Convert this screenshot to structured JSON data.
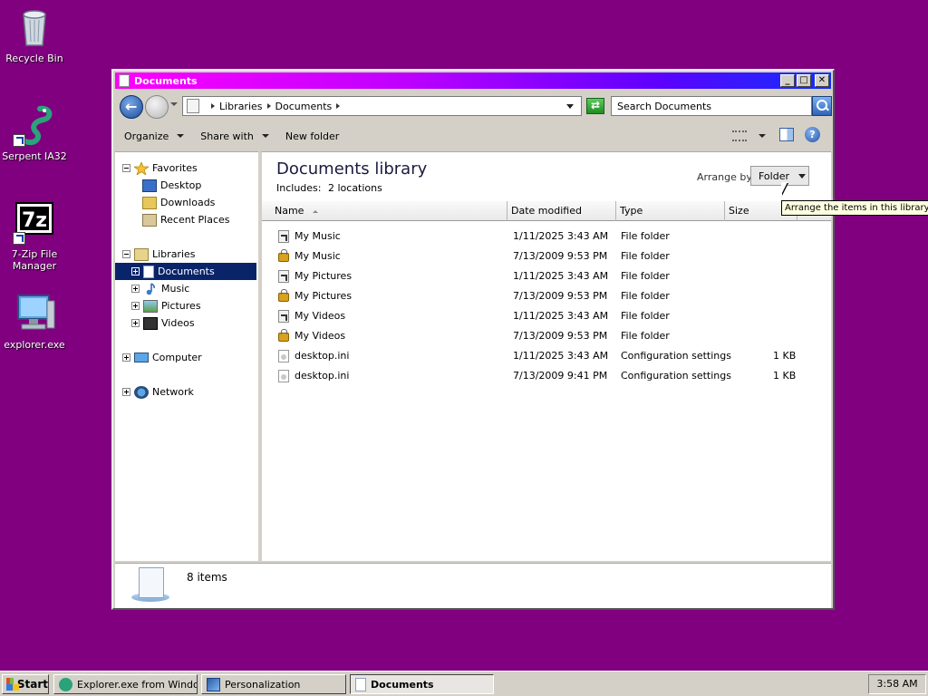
{
  "desktop": {
    "icons": [
      {
        "label": "Recycle Bin"
      },
      {
        "label": "Serpent IA32"
      },
      {
        "label": "7-Zip File Manager"
      },
      {
        "label": "explorer.exe"
      }
    ]
  },
  "window": {
    "title": "Documents",
    "buttons": {
      "minimize": "_",
      "maximize": "□",
      "close": "✕"
    },
    "address": {
      "crumbs": [
        "Libraries",
        "Documents"
      ]
    },
    "search": {
      "placeholder": "Search Documents"
    },
    "toolbar": {
      "organize": "Organize",
      "share_with": "Share with",
      "new_folder": "New folder",
      "help": "?"
    },
    "nav": {
      "favorites": "Favorites",
      "desktop": "Desktop",
      "downloads": "Downloads",
      "recent_places": "Recent Places",
      "libraries": "Libraries",
      "documents": "Documents",
      "music": "Music",
      "pictures": "Pictures",
      "videos": "Videos",
      "computer": "Computer",
      "network": "Network"
    },
    "library": {
      "title": "Documents library",
      "includes_label": "Includes:",
      "includes_link": "2 locations",
      "arrange_label": "Arrange by:",
      "arrange_value": "Folder"
    },
    "columns": {
      "name": "Name",
      "date": "Date modified",
      "type": "Type",
      "size": "Size"
    },
    "files": [
      {
        "icon": "shortcut-folder-icon",
        "name": "My Music",
        "date": "1/11/2025 3:43 AM",
        "type": "File folder",
        "size": ""
      },
      {
        "icon": "locked-folder-icon",
        "name": "My Music",
        "date": "7/13/2009 9:53 PM",
        "type": "File folder",
        "size": ""
      },
      {
        "icon": "shortcut-folder-icon",
        "name": "My Pictures",
        "date": "1/11/2025 3:43 AM",
        "type": "File folder",
        "size": ""
      },
      {
        "icon": "locked-folder-icon",
        "name": "My Pictures",
        "date": "7/13/2009 9:53 PM",
        "type": "File folder",
        "size": ""
      },
      {
        "icon": "shortcut-folder-icon",
        "name": "My Videos",
        "date": "1/11/2025 3:43 AM",
        "type": "File folder",
        "size": ""
      },
      {
        "icon": "locked-folder-icon",
        "name": "My Videos",
        "date": "7/13/2009 9:53 PM",
        "type": "File folder",
        "size": ""
      },
      {
        "icon": "settings-file-icon",
        "name": "desktop.ini",
        "date": "1/11/2025 3:43 AM",
        "type": "Configuration settings",
        "size": "1 KB"
      },
      {
        "icon": "settings-file-icon",
        "name": "desktop.ini",
        "date": "7/13/2009 9:41 PM",
        "type": "Configuration settings",
        "size": "1 KB"
      }
    ],
    "tooltip": "Arrange the items in this library.",
    "details": {
      "count": "8 items"
    }
  },
  "taskbar": {
    "start": "Start",
    "tasks": [
      {
        "label": "Explorer.exe from Windo..."
      },
      {
        "label": "Personalization"
      },
      {
        "label": "Documents"
      }
    ],
    "clock": "3:58 AM"
  },
  "colors": {
    "desktop": "#800080",
    "title_gradient_start": "#ff00ff",
    "title_gradient_end": "#1030ff",
    "selection": "#0a246a"
  }
}
